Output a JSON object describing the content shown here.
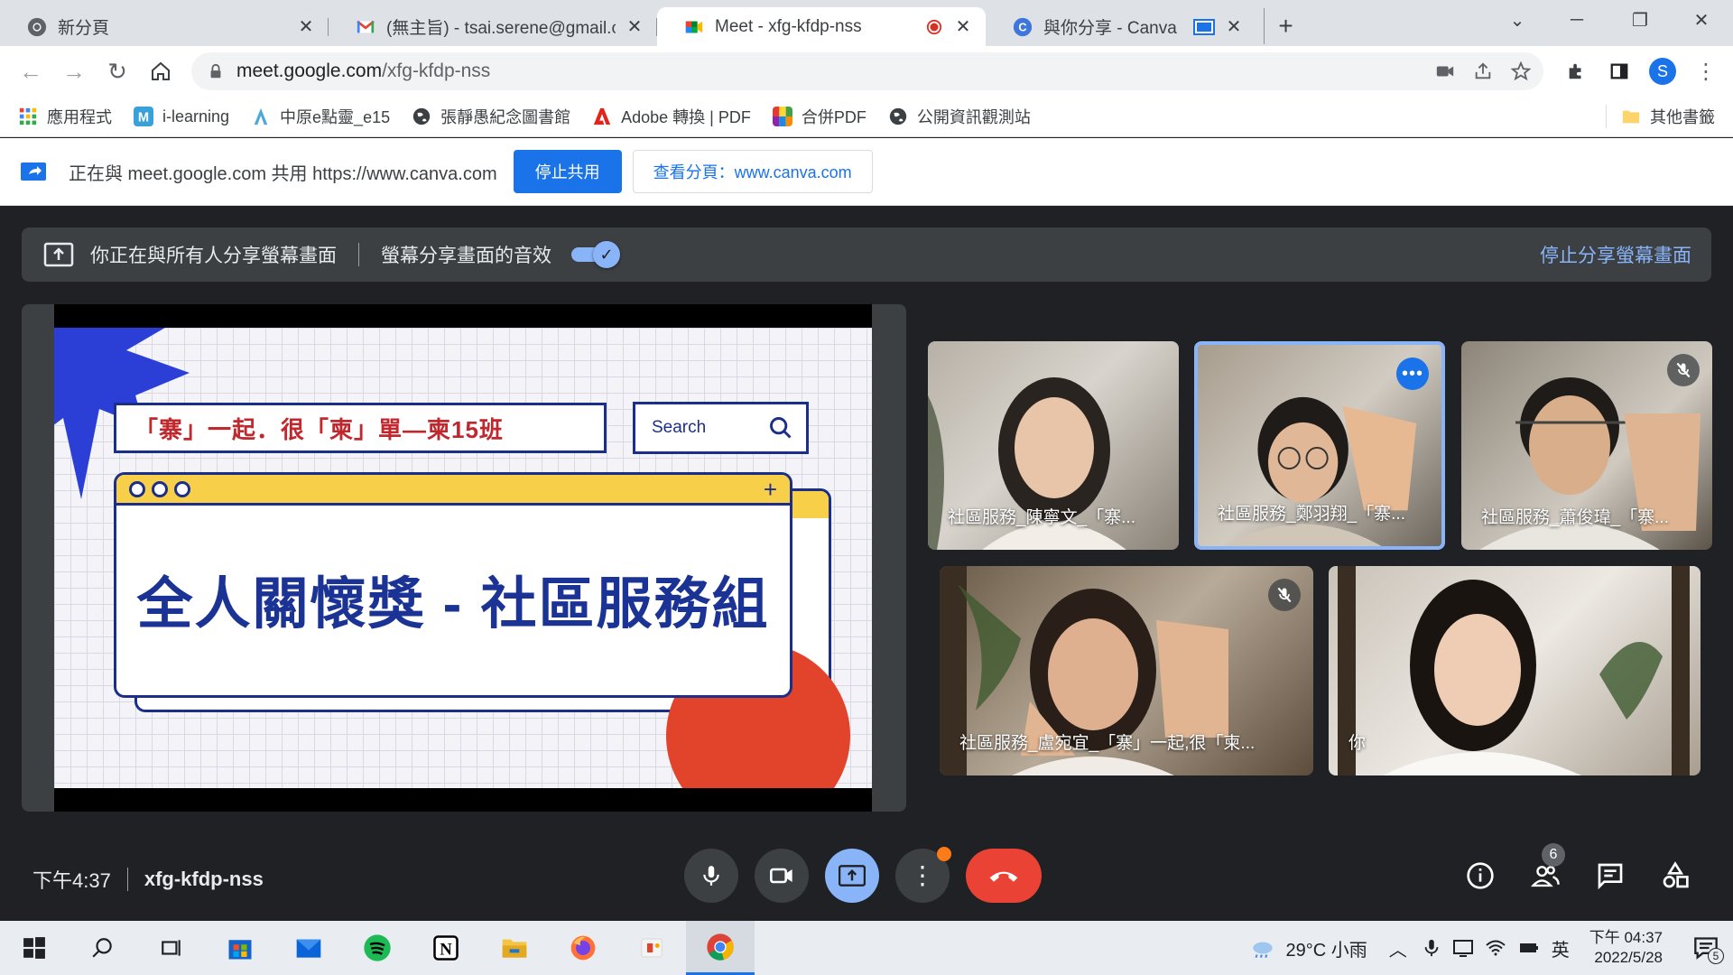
{
  "browser": {
    "tabs": [
      {
        "title": "新分頁",
        "favicon": "chrome-icon",
        "active": false
      },
      {
        "title": "(無主旨) - tsai.serene@gmail.co",
        "favicon": "gmail-icon",
        "active": false
      },
      {
        "title": "Meet - xfg-kfdp-nss",
        "favicon": "meet-icon",
        "active": true,
        "recording": true
      },
      {
        "title": "與你分享 - Canva",
        "favicon": "canva-icon",
        "active": false,
        "sharing": true
      }
    ],
    "url_host": "meet.google.com",
    "url_path": "/xfg-kfdp-nss",
    "profile_initial": "S",
    "bookmarks": [
      "應用程式",
      "i-learning",
      "中原e點靈_e15",
      "張靜愚紀念圖書館",
      "Adobe 轉換 | PDF",
      "合併PDF",
      "公開資訊觀測站"
    ],
    "other_bookmarks": "其他書籤"
  },
  "infobar": {
    "message": "正在與 meet.google.com 共用 https://www.canva.com",
    "stop_label": "停止共用",
    "view_label": "查看分頁：www.canva.com"
  },
  "meet": {
    "sharebar": {
      "sharing_text": "你正在與所有人分享螢幕畫面",
      "audio_text": "螢幕分享畫面的音效",
      "stop_text": "停止分享螢幕畫面"
    },
    "slide": {
      "title": "「寨」一起．很「柬」單—柬15班",
      "search": "Search",
      "headline": "全人關懷獎 - 社區服務組"
    },
    "participants": [
      {
        "name": "社區服務_陳寧文_「寨..."
      },
      {
        "name": "社區服務_鄭羽翔_「寨..."
      },
      {
        "name": "社區服務_蕭俊瑋_「寨..."
      },
      {
        "name": "社區服務_盧宛宜_「寨」一起,很「柬..."
      },
      {
        "name": "你"
      }
    ],
    "time": "下午4:37",
    "meeting_code": "xfg-kfdp-nss",
    "people_count": "6"
  },
  "taskbar": {
    "weather": "29°C  小雨",
    "ime": "英",
    "time": "下午 04:37",
    "date": "2022/5/28",
    "notifications": "5"
  },
  "colors": {
    "meet_bg": "#202124",
    "accent": "#8ab4f8",
    "end_call": "#ea4335",
    "slide_blue": "#1b3394",
    "slide_yellow": "#f7cf48",
    "slide_red": "#e2442b"
  }
}
